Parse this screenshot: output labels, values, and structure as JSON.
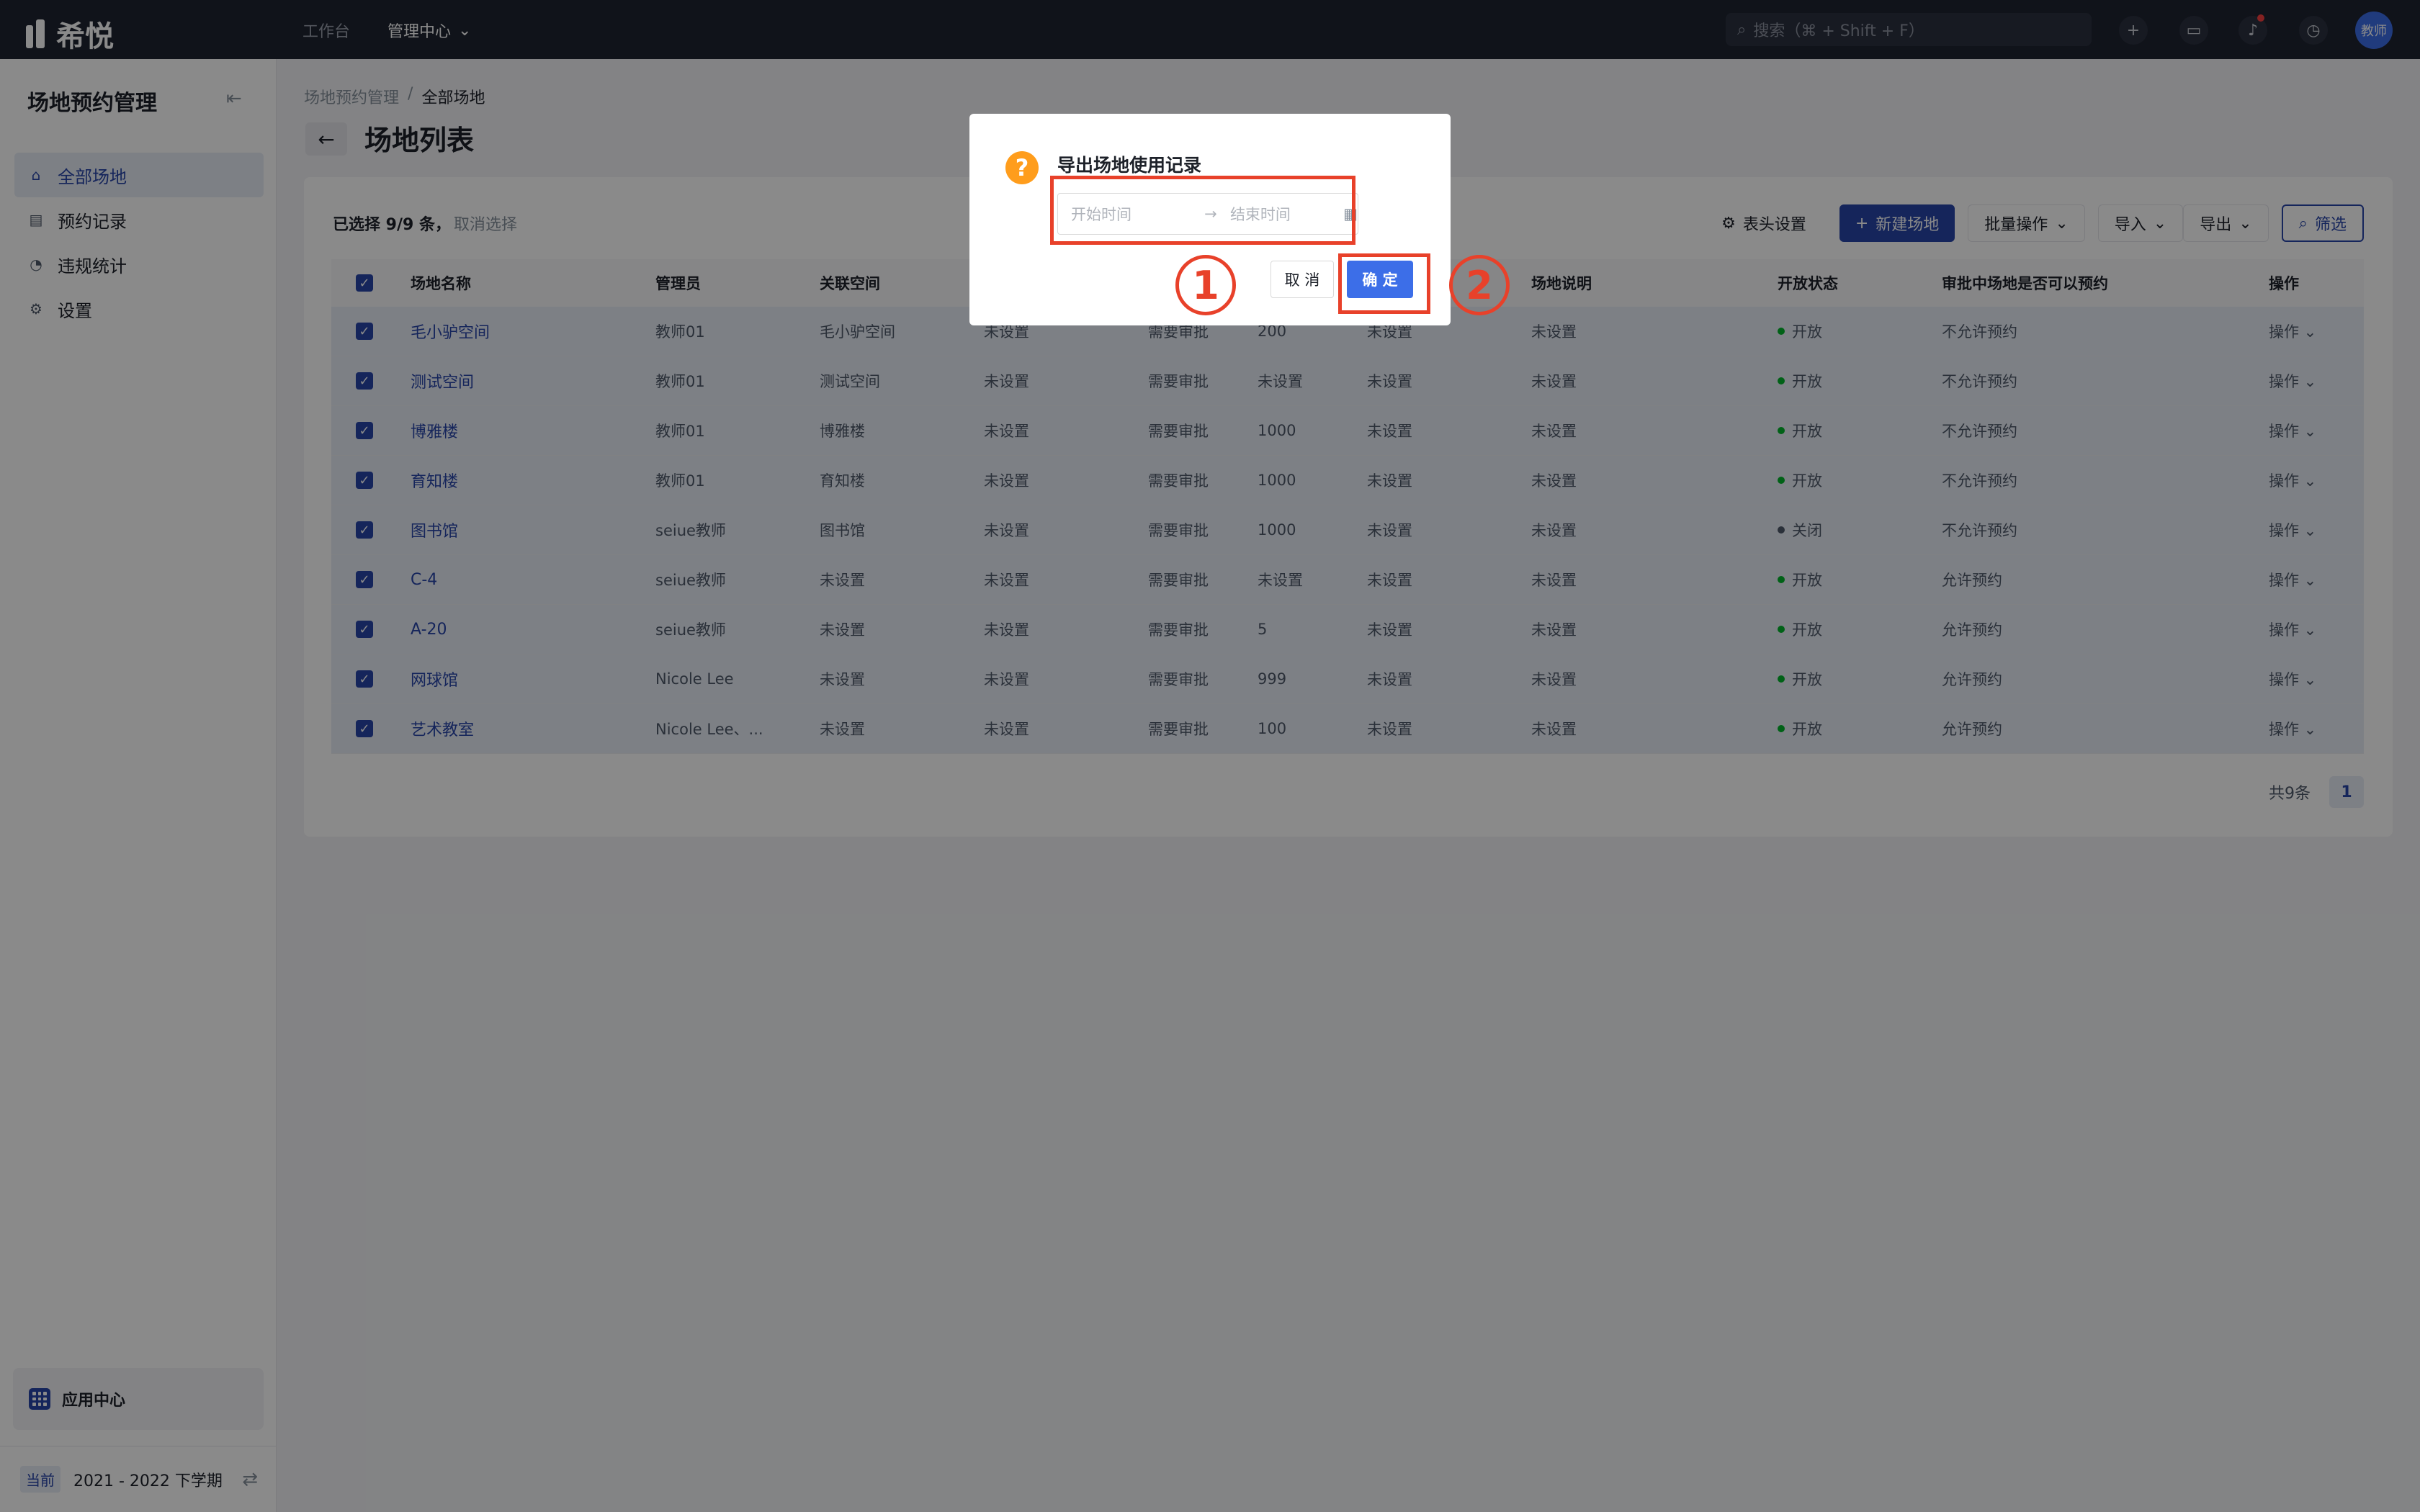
{
  "topbar": {
    "brand": "希悦",
    "nav": {
      "workbench": "工作台",
      "admin_center": "管理中心"
    },
    "search_placeholder": "搜索（⌘ + Shift + F）",
    "avatar_text": "教师"
  },
  "sidebar": {
    "title": "场地预约管理",
    "items": [
      {
        "label": "全部场地",
        "icon": "venue-icon",
        "active": true
      },
      {
        "label": "预约记录",
        "icon": "record-icon",
        "active": false
      },
      {
        "label": "违规统计",
        "icon": "chart-icon",
        "active": false
      },
      {
        "label": "设置",
        "icon": "gear-icon",
        "active": false
      }
    ],
    "app_center": "应用中心",
    "semester_badge": "当前",
    "semester": "2021 - 2022 下学期"
  },
  "breadcrumb": {
    "parent": "场地预约管理",
    "separator": "/",
    "current": "全部场地"
  },
  "page_title": "场地列表",
  "selection": {
    "info": "已选择 9/9 条，",
    "cancel": "取消选择"
  },
  "toolbar": {
    "column_settings": "表头设置",
    "new_venue": "新建场地",
    "batch": "批量操作",
    "import": "导入",
    "export": "导出",
    "filter": "筛选"
  },
  "table": {
    "headers": [
      "场地名称",
      "管理员",
      "关联空间",
      "",
      "",
      "",
      "",
      "场地说明",
      "开放状态",
      "审批中场地是否可以预约",
      "操作"
    ],
    "rows": [
      [
        "毛小驴空间",
        "教师01",
        "毛小驴空间",
        "未设置",
        "需要审批",
        "200",
        "未设置",
        "未设置",
        "开放",
        "不允许预约",
        "操作"
      ],
      [
        "测试空间",
        "教师01",
        "测试空间",
        "未设置",
        "需要审批",
        "未设置",
        "未设置",
        "未设置",
        "开放",
        "不允许预约",
        "操作"
      ],
      [
        "博雅楼",
        "教师01",
        "博雅楼",
        "未设置",
        "需要审批",
        "1000",
        "未设置",
        "未设置",
        "开放",
        "不允许预约",
        "操作"
      ],
      [
        "育知楼",
        "教师01",
        "育知楼",
        "未设置",
        "需要审批",
        "1000",
        "未设置",
        "未设置",
        "开放",
        "不允许预约",
        "操作"
      ],
      [
        "图书馆",
        "seiue教师",
        "图书馆",
        "未设置",
        "需要审批",
        "1000",
        "未设置",
        "未设置",
        "关闭",
        "不允许预约",
        "操作"
      ],
      [
        "C-4",
        "seiue教师",
        "未设置",
        "未设置",
        "需要审批",
        "未设置",
        "未设置",
        "未设置",
        "开放",
        "允许预约",
        "操作"
      ],
      [
        "A-20",
        "seiue教师",
        "未设置",
        "未设置",
        "需要审批",
        "5",
        "未设置",
        "未设置",
        "开放",
        "允许预约",
        "操作"
      ],
      [
        "网球馆",
        "Nicole Lee",
        "未设置",
        "未设置",
        "需要审批",
        "999",
        "未设置",
        "未设置",
        "开放",
        "允许预约",
        "操作"
      ],
      [
        "艺术教室",
        "Nicole Lee、...",
        "未设置",
        "未设置",
        "需要审批",
        "100",
        "未设置",
        "未设置",
        "开放",
        "允许预约",
        "操作"
      ]
    ],
    "status_colors": {
      "开放": "#00b42a",
      "关闭": "#4e5969"
    }
  },
  "pagination": {
    "total": "共9条",
    "current_page": "1"
  },
  "dialog": {
    "title": "导出场地使用记录",
    "start_placeholder": "开始时间",
    "end_placeholder": "结束时间",
    "cancel": "取 消",
    "confirm": "确 定"
  },
  "annotations": {
    "step1": "1",
    "step2": "2",
    "color": "#e8412a"
  }
}
